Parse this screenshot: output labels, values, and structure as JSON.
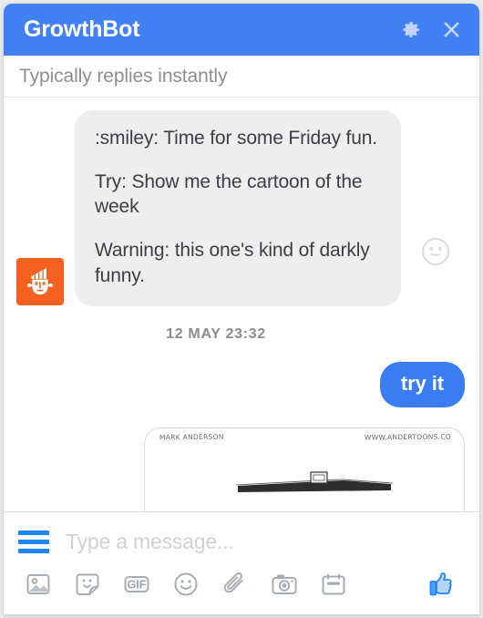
{
  "header": {
    "title": "GrowthBot",
    "settings_icon": "gear-icon",
    "close_icon": "close-icon",
    "background_color": "#4280f5"
  },
  "status": {
    "subtitle": "Typically replies instantly"
  },
  "conversation": {
    "avatar_icon": "growthbot-logo-icon",
    "avatar_color": "#f4601d",
    "bot_message": {
      "paragraphs": [
        ":smiley: Time for some Friday fun.",
        "Try: Show me the cartoon of the week",
        "Warning: this one's kind of darkly funny."
      ],
      "reaction_icon": "smiley-reaction-icon",
      "bubble_color": "#eeeeee"
    },
    "timestamp": "12 MAY 23:32",
    "user_message": {
      "text": "try it",
      "bubble_color": "#3a7df2"
    },
    "attachment": {
      "credit_left": "MARK ANDERSON",
      "credit_right": "WWW.ANDERTOONS.CO"
    }
  },
  "composer": {
    "menu_icon": "hamburger-menu-icon",
    "input_value": "",
    "input_placeholder": "Type a message...",
    "accent_color": "#1f86fb",
    "tools": [
      {
        "name": "image-icon",
        "label": "Image"
      },
      {
        "name": "sticker-icon",
        "label": "Sticker"
      },
      {
        "name": "gif-icon",
        "label": "GIF"
      },
      {
        "name": "emoji-icon",
        "label": "Emoji"
      },
      {
        "name": "paperclip-icon",
        "label": "Attachment"
      },
      {
        "name": "camera-icon",
        "label": "Camera"
      },
      {
        "name": "calendar-icon",
        "label": "Meeting"
      }
    ],
    "gif_label": "GIF",
    "send_icon": "thumbs-up-icon"
  }
}
